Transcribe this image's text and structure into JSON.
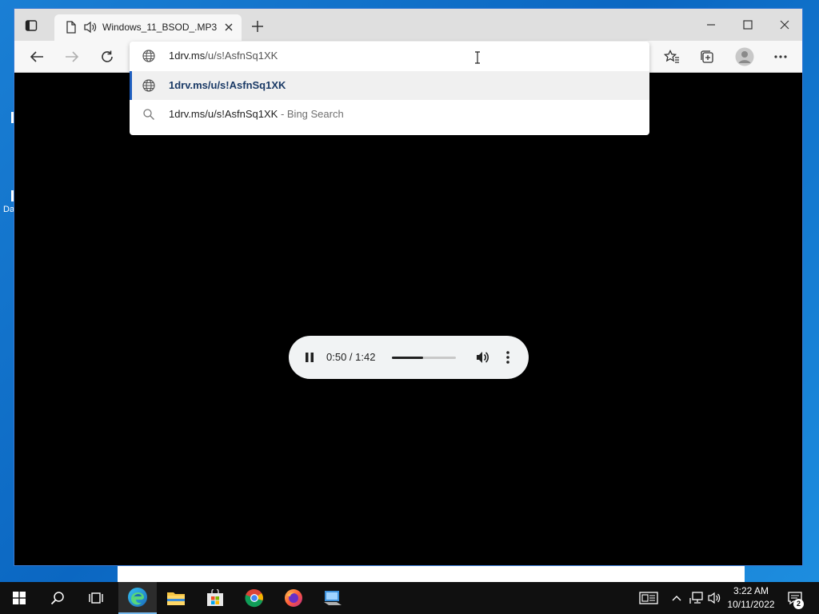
{
  "desktop": {
    "fragment_label": "Da"
  },
  "browser": {
    "tab": {
      "title": "Windows_11_BSOD_.MP3"
    },
    "icons": {
      "tab_actions": "tab-actions-icon",
      "doc": "document-icon",
      "speaker": "speaker-icon",
      "back": "arrow-left-icon",
      "forward": "arrow-right-icon",
      "refresh": "refresh-icon",
      "favorites": "star-list-icon",
      "collections": "collections-icon",
      "profile": "profile-icon",
      "more": "ellipsis-icon"
    },
    "omnibox": {
      "input_host": "1drv.ms",
      "input_path": "/u/s!AsfnSq1XK",
      "suggestion_url": "1drv.ms/u/s!AsfnSq1XK",
      "search_query": "1drv.ms/u/s!AsfnSq1XK",
      "search_suffix": " - Bing Search"
    }
  },
  "player": {
    "time": "0:50 / 1:42",
    "progress_fraction": 0.49
  },
  "taskbar": {
    "clock_time": "3:22 AM",
    "clock_date": "10/11/2022",
    "notification_count": "2",
    "accent": "#76b9ed"
  }
}
